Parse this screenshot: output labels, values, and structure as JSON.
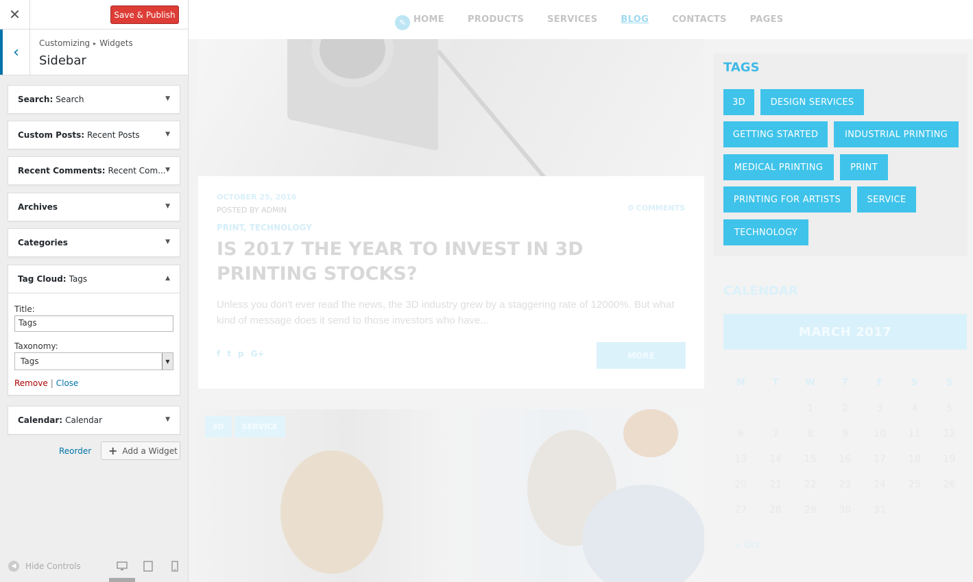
{
  "customizer": {
    "close_label": "✕",
    "save_label": "Save & Publish",
    "breadcrumb": {
      "root": "Customizing",
      "separator": "▸",
      "current": "Widgets"
    },
    "section_title": "Sidebar",
    "back_icon": "‹",
    "widgets": [
      {
        "type": "Search:",
        "title": "Search"
      },
      {
        "type": "Custom Posts:",
        "title": "Recent Posts"
      },
      {
        "type": "Recent Comments:",
        "title": "Recent Com..."
      },
      {
        "type": "Archives",
        "title": ""
      },
      {
        "type": "Categories",
        "title": ""
      },
      {
        "type": "Tag Cloud:",
        "title": "Tags"
      },
      {
        "type": "Calendar:",
        "title": "Calendar"
      }
    ],
    "tag_cloud_form": {
      "title_label": "Title:",
      "title_value": "Tags",
      "taxonomy_label": "Taxonomy:",
      "taxonomy_value": "Tags",
      "remove_label": "Remove",
      "separator": "|",
      "close_label": "Close"
    },
    "reorder_label": "Reorder",
    "add_widget_label": "Add a Widget",
    "hide_controls_label": "Hide Controls"
  },
  "site": {
    "nav": [
      "HOME",
      "PRODUCTS",
      "SERVICES",
      "BLOG",
      "CONTACTS",
      "PAGES"
    ],
    "post1": {
      "date": "OCTOBER 25, 2016",
      "posted_by": "POSTED BY ADMIN",
      "comments": "0 COMMENTS",
      "categories": "PRINT, TECHNOLOGY",
      "title": "IS 2017 THE YEAR TO INVEST IN 3D PRINTING STOCKS?",
      "excerpt": "Unless you don't ever read the news, the 3D industry grew by a staggering rate of 12000%. But what kind of message does it send to those investors who have...",
      "social": [
        "f",
        "t",
        "p",
        "G+"
      ],
      "more_label": "MORE"
    },
    "post2": {
      "tags": [
        "3D",
        "SERVICE"
      ]
    },
    "tags_widget": {
      "title": "TAGS",
      "tags": [
        "3D",
        "DESIGN SERVICES",
        "GETTING STARTED",
        "INDUSTRIAL PRINTING",
        "MEDICAL PRINTING",
        "PRINT",
        "PRINTING FOR ARTISTS",
        "SERVICE",
        "TECHNOLOGY"
      ]
    },
    "calendar": {
      "title": "CALENDAR",
      "month": "MARCH 2017",
      "weekdays": [
        "M",
        "T",
        "W",
        "T",
        "F",
        "S",
        "S"
      ],
      "weeks": [
        [
          "",
          "",
          "1",
          "2",
          "3",
          "4",
          "5"
        ],
        [
          "6",
          "7",
          "8",
          "9",
          "10",
          "11",
          "12"
        ],
        [
          "13",
          "14",
          "15",
          "16",
          "17",
          "18",
          "19"
        ],
        [
          "20",
          "21",
          "22",
          "23",
          "24",
          "25",
          "26"
        ],
        [
          "27",
          "28",
          "29",
          "30",
          "31",
          "",
          ""
        ]
      ],
      "prev_link": "« Oct"
    }
  },
  "colors": {
    "save_button": "#dd3d36",
    "accent_blue": "#0073aa",
    "tag_blue": "#3fc3ea",
    "tags_title": "#3fb9e6"
  }
}
